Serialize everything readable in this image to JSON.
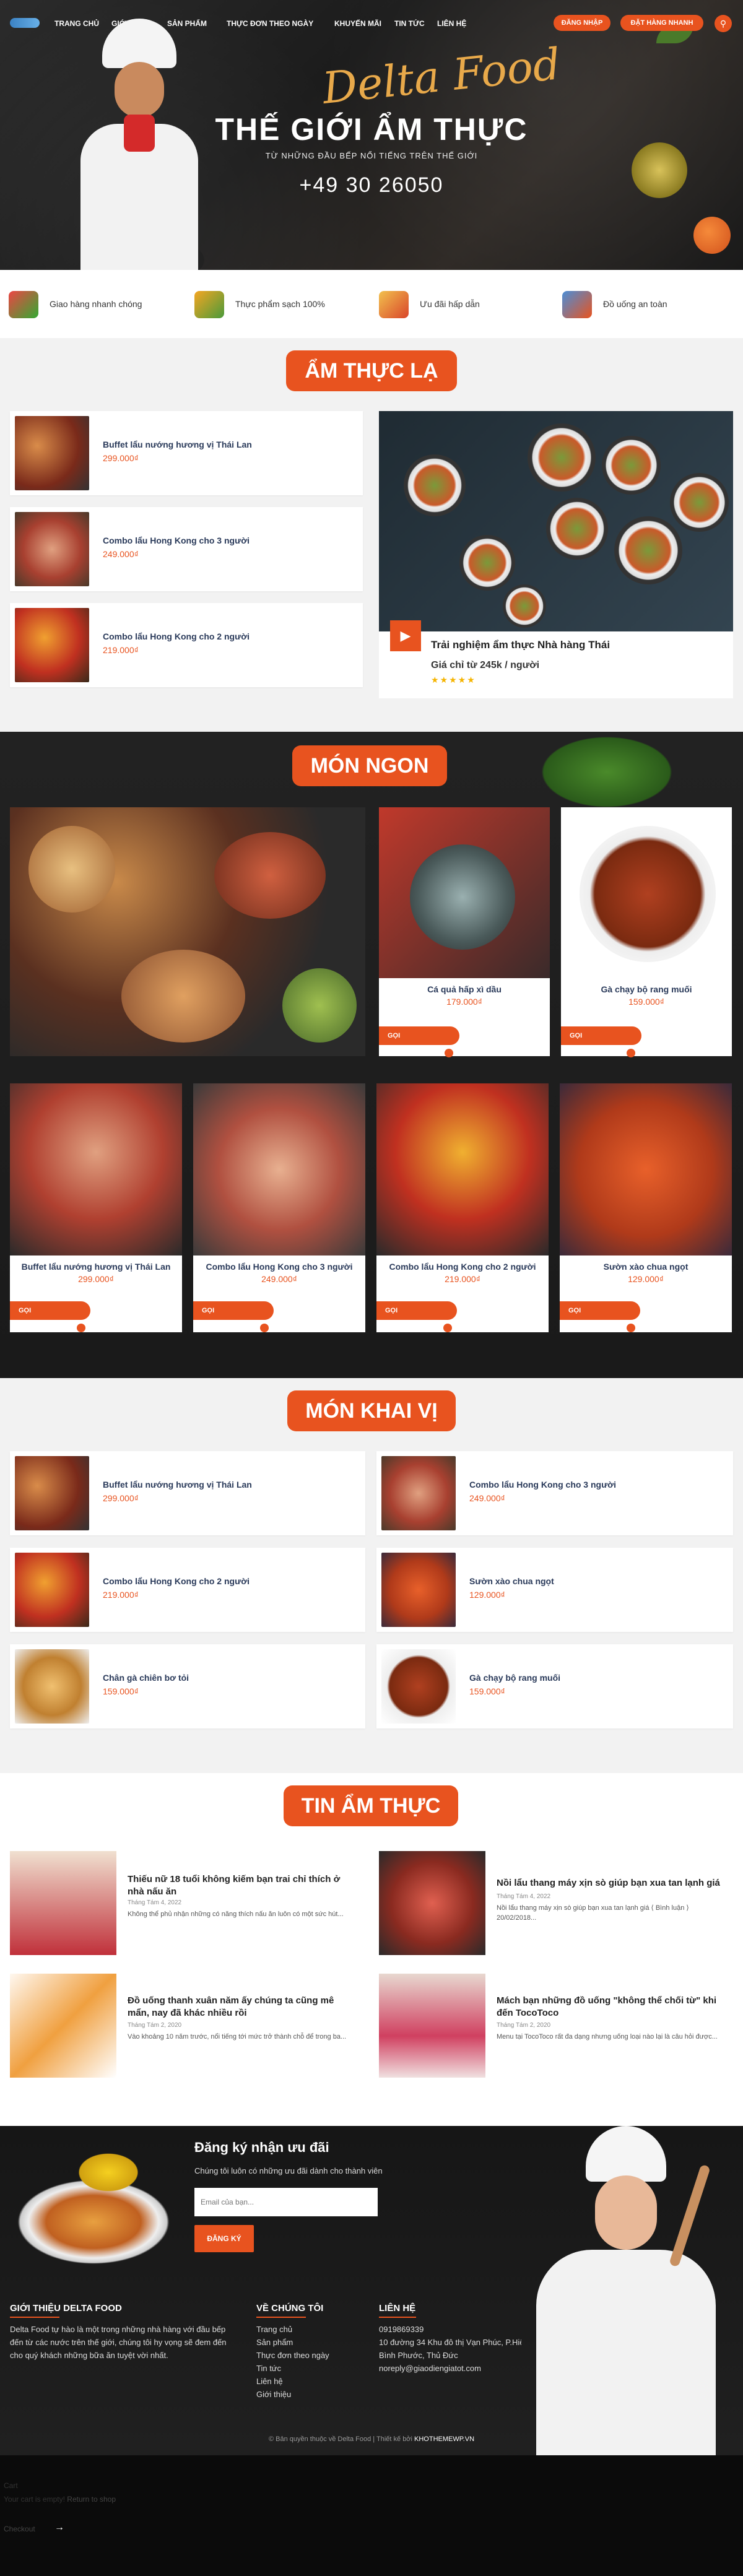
{
  "nav": {
    "items": [
      "TRANG CHỦ",
      "GIỚI THIỆU",
      "SẢN PHẨM",
      "THỰC ĐƠN THEO NGÀY",
      "KHUYẾN MÃI",
      "TIN TỨC",
      "LIÊN HỆ"
    ],
    "login": "ĐĂNG NHẬP",
    "quick_order": "ĐẶT HÀNG NHANH"
  },
  "hero": {
    "script": "Delta Food",
    "title": "THẾ GIỚI ẨM THỰC",
    "subtitle": "TỪ NHỮNG ĐẦU BẾP NỔI TIẾNG TRÊN THẾ GIỚI",
    "phone": "+49 30 26050"
  },
  "features": [
    "Giao hàng nhanh chóng",
    "Thực phẩm sạch 100%",
    "Ưu đãi hấp dẫn",
    "Đồ uống an toàn"
  ],
  "am_thuc_la": {
    "title": "ẨM THỰC LẠ",
    "items": [
      {
        "name": "Buffet lẩu nướng hương vị Thái Lan",
        "price": "299.000₫"
      },
      {
        "name": "Combo lẩu Hong Kong cho 3 người",
        "price": "249.000₫"
      },
      {
        "name": "Combo lẩu Hong Kong cho 2 người",
        "price": "219.000₫"
      }
    ],
    "featured": {
      "title": "Trải nghiệm ẩm thực Nhà hàng Thái",
      "price_text": "Giá chỉ từ 245k / người",
      "stars": "★★★★★"
    }
  },
  "mon_ngon": {
    "title": "MÓN NGON",
    "button": "GỌI",
    "items": [
      {
        "name": "Cá quả hấp xì dầu",
        "price": "179.000₫"
      },
      {
        "name": "Gà chạy bộ rang muối",
        "price": "159.000₫"
      },
      {
        "name": "Buffet lẩu nướng hương vị Thái Lan",
        "price": "299.000₫"
      },
      {
        "name": "Combo lẩu Hong Kong cho 3 người",
        "price": "249.000₫"
      },
      {
        "name": "Combo lẩu Hong Kong cho 2 người",
        "price": "219.000₫"
      },
      {
        "name": "Sườn xào chua ngọt",
        "price": "129.000₫"
      }
    ]
  },
  "mon_khai_vi": {
    "title": "MÓN KHAI VỊ",
    "items": [
      {
        "name": "Buffet lẩu nướng hương vị Thái Lan",
        "price": "299.000₫"
      },
      {
        "name": "Combo lẩu Hong Kong cho 3 người",
        "price": "249.000₫"
      },
      {
        "name": "Combo lẩu Hong Kong cho 2 người",
        "price": "219.000₫"
      },
      {
        "name": "Sườn xào chua ngọt",
        "price": "129.000₫"
      },
      {
        "name": "Chân gà chiên bơ tỏi",
        "price": "159.000₫"
      },
      {
        "name": "Gà chạy bộ rang muối",
        "price": "159.000₫"
      }
    ]
  },
  "news": {
    "title": "TIN ẨM THỰC",
    "items": [
      {
        "title": "Thiếu nữ 18 tuổi không kiếm bạn trai chỉ thích ở nhà nấu ăn",
        "date": "Tháng Tám 4, 2022",
        "excerpt": "Không thể phủ nhận những có năng thích nấu ăn luôn có một sức hút..."
      },
      {
        "title": "Nồi lẩu thang máy xịn sò giúp bạn xua tan lạnh giá",
        "date": "Tháng Tám 4, 2022",
        "excerpt": "Nồi lẩu thang máy xịn sò giúp bạn xua tan lạnh giá ⟨ Bình luận ⟩ 20/02/2018..."
      },
      {
        "title": "Đồ uống thanh xuân năm ấy chúng ta cũng mê mẩn, nay đã khác nhiều rồi",
        "date": "Tháng Tám 2, 2020",
        "excerpt": "Vào khoảng 10 năm trước, nổi tiếng tới mức trở thành chỗ để trong ba..."
      },
      {
        "title": "Mách bạn những đồ uống \"không thể chối từ\" khi đến TocoToco",
        "date": "Tháng Tám 2, 2020",
        "excerpt": "Menu tại TocoToco rất đa dạng nhưng uống loại nào lại là câu hỏi được..."
      }
    ]
  },
  "footer": {
    "subscribe_title": "Đăng ký nhận ưu đãi",
    "subscribe_sub": "Chúng tôi luôn có những ưu đãi dành cho thành viên",
    "email_placeholder": "Email của bạn...",
    "subscribe_button": "ĐĂNG KÝ",
    "about_title": "GIỚI THIỆU DELTA FOOD",
    "about_text": "Delta Food tự hào là một trong những nhà hàng với đầu bếp đến từ các nước trên thế giới, chúng tôi hy vọng sẽ đem đến cho quý khách những bữa ăn tuyệt vời nhất.",
    "links_title": "VỀ CHÚNG TÔI",
    "links": [
      "Trang chủ",
      "Sản phẩm",
      "Thực đơn theo ngày",
      "Tin tức",
      "Liên hệ",
      "Giới thiệu"
    ],
    "contact_title": "LIÊN HỆ",
    "contact": [
      "0919869339",
      "10 đường 34 Khu đô thị Vạn Phúc, P.Hiệp",
      "Bình Phước, Thủ Đức",
      "noreply@giaodiengiatot.com"
    ],
    "copyright_pre": "© Bản quyền thuộc về Delta Food | Thiết kế bởi",
    "copyright_brand": "KHOTHEMEWP.VN"
  },
  "cart": {
    "title": "Cart",
    "empty": "Your cart is empty!",
    "return": "Return to shop",
    "checkout": "Checkout"
  }
}
